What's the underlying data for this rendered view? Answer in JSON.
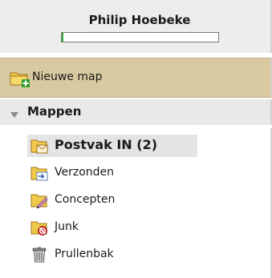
{
  "user": {
    "name": "Philip Hoebeke",
    "quota_used_fraction": 0.01
  },
  "actions": {
    "new_folder_label": "Nieuwe map"
  },
  "section": {
    "label": "Mappen",
    "expanded": true
  },
  "folders": [
    {
      "label": "Postvak IN (2)",
      "icon": "inbox-folder-icon",
      "selected": true
    },
    {
      "label": "Verzonden",
      "icon": "sent-folder-icon",
      "selected": false
    },
    {
      "label": "Concepten",
      "icon": "drafts-folder-icon",
      "selected": false
    },
    {
      "label": "Junk",
      "icon": "junk-folder-icon",
      "selected": false
    },
    {
      "label": "Prullenbak",
      "icon": "trash-icon",
      "selected": false
    }
  ],
  "colors": {
    "header_bg": "#ededec",
    "new_folder_bg": "#d8c9a0",
    "section_bg": "#e9e9e8",
    "selected_bg": "#e4e4e4",
    "quota_fill": "#2fae3c",
    "folder_yellow": "#f0c94a"
  }
}
